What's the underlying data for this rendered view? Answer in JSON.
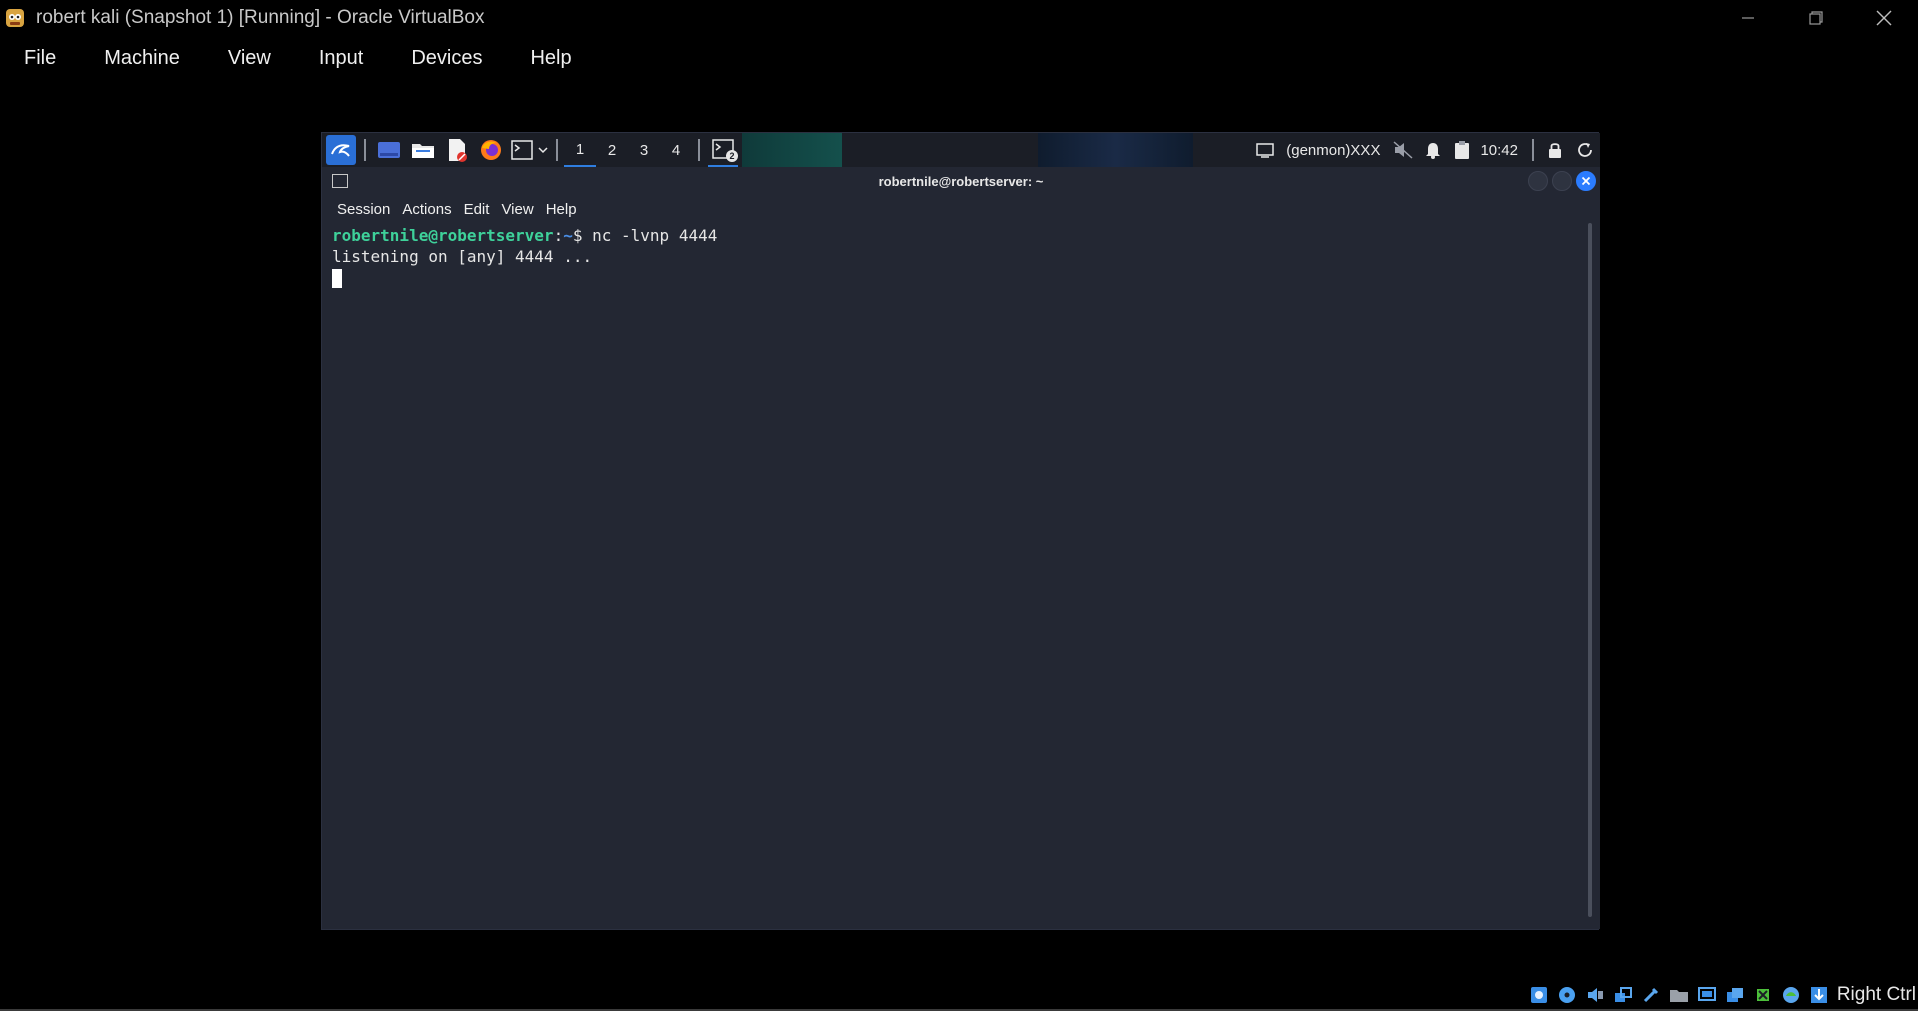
{
  "window": {
    "title": "robert kali (Snapshot 1) [Running] - Oracle VirtualBox"
  },
  "menubar": [
    {
      "label": "File"
    },
    {
      "label": "Machine"
    },
    {
      "label": "View"
    },
    {
      "label": "Input"
    },
    {
      "label": "Devices"
    },
    {
      "label": "Help"
    }
  ],
  "panel": {
    "workspaces": [
      "1",
      "2",
      "3",
      "4"
    ],
    "active_workspace": "1",
    "genmon_label": "(genmon)XXX",
    "clock": "10:42",
    "terminal_badge": "2"
  },
  "terminal": {
    "title": "robertnile@robertserver: ~",
    "menu": [
      "Session",
      "Actions",
      "Edit",
      "View",
      "Help"
    ],
    "prompt_user": "robertnile@robertserver",
    "prompt_sep": ":",
    "prompt_path": "~",
    "prompt_symbol": "$",
    "command": " nc -lvnp 4444",
    "output_line": "listening on [any] 4444 ..."
  },
  "statusbar": {
    "host_key": "Right Ctrl"
  },
  "colors": {
    "background": "#000000",
    "guest_bg": "#232733",
    "prompt_user": "#3ed19a",
    "prompt_path": "#4a8fe8",
    "accent": "#2b7cff"
  }
}
